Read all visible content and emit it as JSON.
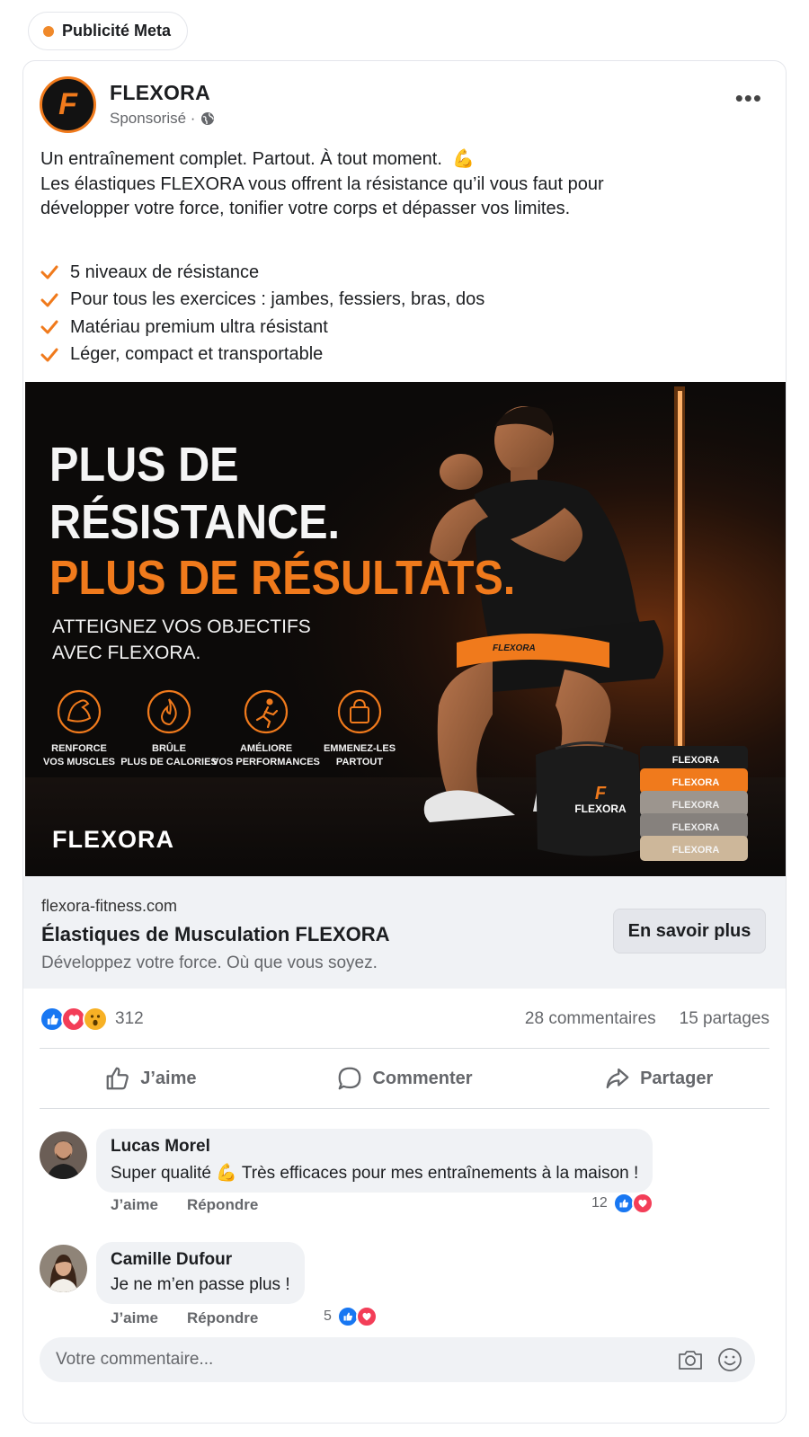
{
  "badge": {
    "label": "Publicité Meta"
  },
  "post": {
    "page_name": "FLEXORA",
    "logo_letter": "F",
    "sponsored": "Sponsorisé ·",
    "text_line1": "Un entraînement complet. Partout. À tout moment.",
    "text_emoji": "💪",
    "text_body": "Les élastiques FLEXORA vous offrent la résistance qu’il vous faut pour développer votre force, tonifier votre corps et dépasser vos limites.",
    "bullets": [
      "5 niveaux de résistance",
      "Pour tous les exercices : jambes, fessiers, bras, dos",
      "Matériau premium ultra résistant",
      "Léger, compact et transportable"
    ]
  },
  "hero": {
    "headline1": "PLUS DE",
    "headline2": "RÉSISTANCE.",
    "headline3": "PLUS DE RÉSULTATS.",
    "sub1": "ATTEIGNEZ VOS OBJECTIFS",
    "sub2": "AVEC FLEXORA.",
    "features": [
      {
        "icon": "bicep-icon",
        "line1": "RENFORCE",
        "line2": "VOS MUSCLES"
      },
      {
        "icon": "flame-icon",
        "line1": "BRÛLE",
        "line2": "PLUS DE CALORIES"
      },
      {
        "icon": "runner-icon",
        "line1": "AMÉLIORE",
        "line2": "VOS PERFORMANCES"
      },
      {
        "icon": "bag-icon",
        "line1": "EMMENEZ-LES",
        "line2": "PARTOUT"
      }
    ],
    "brand": "FLEXORA",
    "band_text": "FLEXORA",
    "bag_text": "FLEXORA",
    "bands": [
      "FLEXORA",
      "FLEXORA",
      "FLEXORA",
      "FLEXORA",
      "FLEXORA"
    ]
  },
  "link": {
    "domain": "flexora-fitness.com",
    "title": "Élastiques de Musculation FLEXORA",
    "description": "Développez votre force. Où que vous soyez.",
    "cta": "En savoir plus"
  },
  "stats": {
    "reactions": "312",
    "comments": "28 commentaires",
    "shares": "15 partages"
  },
  "actions": {
    "like": "J’aime",
    "comment": "Commenter",
    "share": "Partager"
  },
  "comments": [
    {
      "name": "Lucas Morel",
      "text": "Super qualité",
      "emoji": "💪",
      "text_after": "Très efficaces pour mes entraînements à la maison !",
      "like": "J’aime",
      "reply": "Répondre",
      "count": "12"
    },
    {
      "name": "Camille Dufour",
      "text": "Je ne m’en passe plus !",
      "like": "J’aime",
      "reply": "Répondre",
      "count": "5"
    }
  ],
  "composer": {
    "placeholder": "Votre commentaire..."
  },
  "colors": {
    "accent": "#f07a1c",
    "facebook_blue": "#1877f2",
    "love_red": "#f33e58"
  }
}
